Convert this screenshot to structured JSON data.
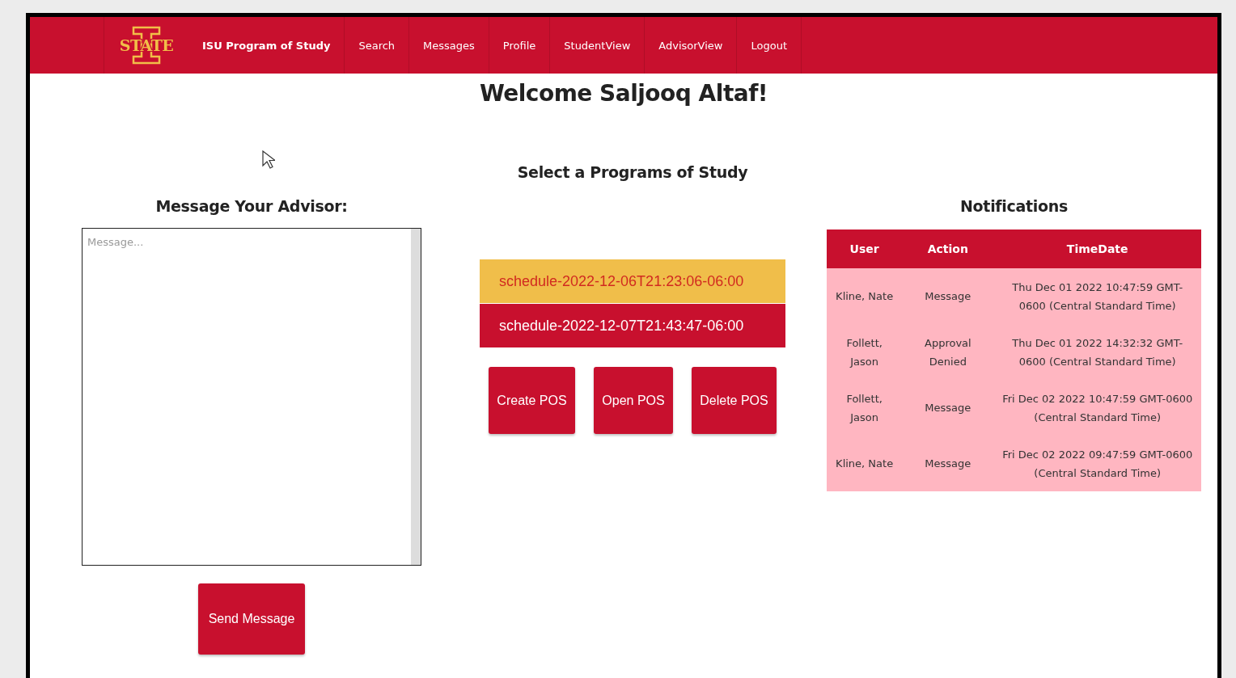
{
  "nav": {
    "logo": "STATE",
    "brand": "ISU Program of Study",
    "items": [
      {
        "label": "Search"
      },
      {
        "label": "Messages"
      },
      {
        "label": "Profile"
      },
      {
        "label": "StudentView"
      },
      {
        "label": "AdvisorView"
      },
      {
        "label": "Logout"
      }
    ]
  },
  "title": "Welcome Saljooq Altaf!",
  "message": {
    "heading": "Message Your Advisor:",
    "placeholder": "Message...",
    "button": "Send Message"
  },
  "programs": {
    "heading": "Select a Programs of Study",
    "schedules": [
      {
        "label": "schedule-2022-12-06T21:23:06-06:00",
        "selected": true
      },
      {
        "label": "schedule-2022-12-07T21:43:47-06:00",
        "selected": false
      }
    ],
    "buttons": [
      "Create POS",
      "Open POS",
      "Delete POS"
    ]
  },
  "notifications": {
    "heading": "Notifications",
    "columns": [
      "User",
      "Action",
      "TimeDate"
    ],
    "rows": [
      [
        "Kline, Nate",
        "Message",
        "Thu Dec 01 2022 10:47:59 GMT-0600 (Central Standard Time)"
      ],
      [
        "Follett, Jason",
        "Approval Denied",
        "Thu Dec 01 2022 14:32:32 GMT-0600 (Central Standard Time)"
      ],
      [
        "Follett, Jason",
        "Message",
        "Fri Dec 02 2022 10:47:59 GMT-0600 (Central Standard Time)"
      ],
      [
        "Kline, Nate",
        "Message",
        "Fri Dec 02 2022 09:47:59 GMT-0600 (Central Standard Time)"
      ]
    ]
  }
}
